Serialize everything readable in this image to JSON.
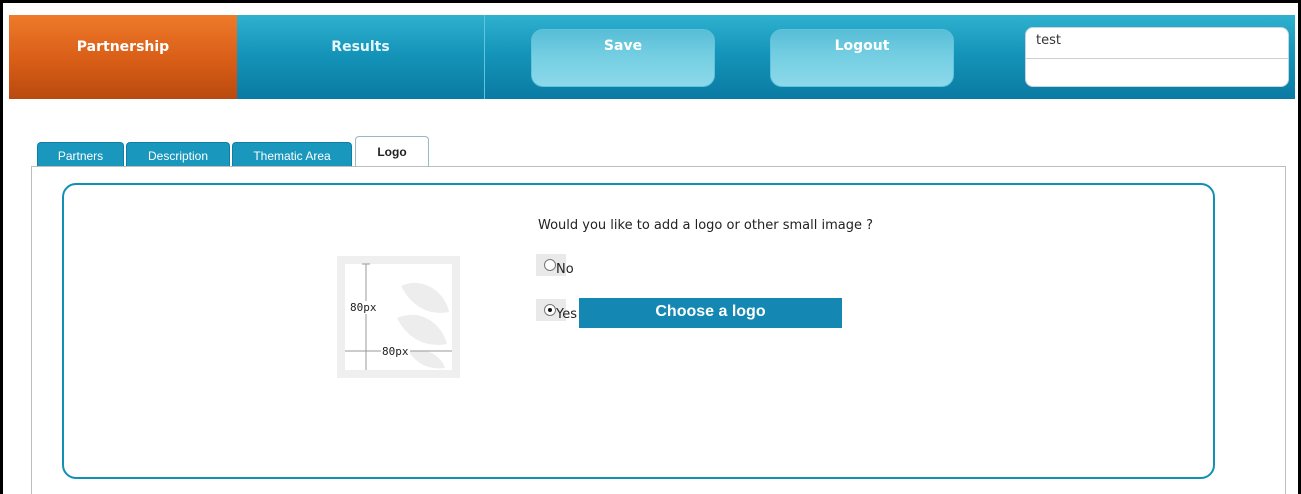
{
  "nav": {
    "partnership_label": "Partnership",
    "results_label": "Results",
    "save_label": "Save",
    "logout_label": "Logout",
    "user_name": "test"
  },
  "tabs": [
    {
      "label": "Partners"
    },
    {
      "label": "Description"
    },
    {
      "label": "Thematic Area"
    },
    {
      "label": "Logo",
      "active": true
    }
  ],
  "logo_section": {
    "question": "Would you like to add a logo or other small image ?",
    "preview_height_label": "80px",
    "preview_width_label": "80px",
    "option_no": "No",
    "option_yes": "Yes",
    "selected": "Yes",
    "choose_button_label": "Choose a logo"
  },
  "colors": {
    "accent_orange": "#d85d17",
    "accent_teal": "#1595b9",
    "button_blue": "#1487b2"
  }
}
